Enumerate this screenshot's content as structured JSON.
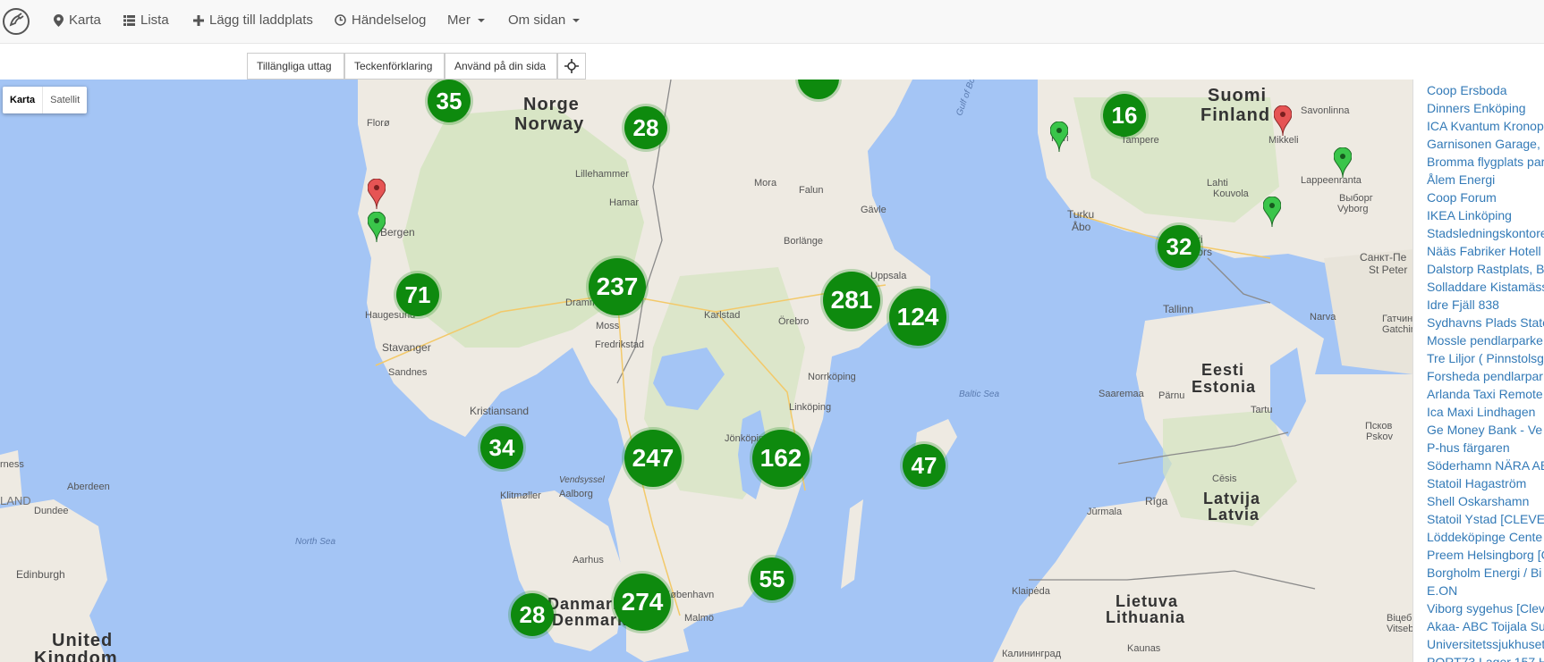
{
  "nav": {
    "items": [
      {
        "label": "Karta",
        "icon": "map-marker-icon"
      },
      {
        "label": "Lista",
        "icon": "list-icon"
      },
      {
        "label": "Lägg till laddplats",
        "icon": "plus-icon"
      },
      {
        "label": "Händelselog",
        "icon": "clock-icon"
      },
      {
        "label": "Mer",
        "icon": "caret-icon"
      },
      {
        "label": "Om sidan",
        "icon": "caret-icon"
      }
    ]
  },
  "toolbar": {
    "available_label": "Tillängliga uttag",
    "legend_label": "Teckenförklaring",
    "use_label": "Använd på din sida",
    "locate_icon": "crosshair-icon"
  },
  "map": {
    "type_control": {
      "map_label": "Karta",
      "satellite_label": "Satellit"
    },
    "clusters": [
      35,
      28,
      16,
      32,
      71,
      237,
      281,
      124,
      34,
      247,
      162,
      47,
      55,
      274,
      28
    ],
    "labels": {
      "norge": "Norge",
      "norway": "Norway",
      "suomi": "Suomi",
      "finland": "Finland",
      "eesti": "Eesti",
      "estonia": "Estonia",
      "latvija": "Latvija",
      "latvia": "Latvia",
      "lietuva": "Lietuva",
      "lithuania": "Lithuania",
      "united": "United",
      "kingdom": "Kingdom",
      "danmark": "Danmark",
      "denmark": "Denmark",
      "north_sea": "North Sea",
      "baltic_sea": "Baltic Sea",
      "gulf_bothnia": "Gulf of Both",
      "floro": "Florø",
      "bergen": "Bergen",
      "haugesund": "Haugesund",
      "stavanger": "Stavanger",
      "sandnes": "Sandnes",
      "kristiansand": "Kristiansand",
      "lillehammer": "Lillehammer",
      "hamar": "Hamar",
      "drammen": "Dramm",
      "moss": "Moss",
      "fredrikstad": "Fredrikstad",
      "karlstad": "Karlstad",
      "orebro": "Örebro",
      "mora": "Mora",
      "falun": "Falun",
      "borlange": "Borlänge",
      "gavle": "Gävle",
      "uppsala": "Uppsala",
      "norrkoping": "Norrköping",
      "linkoping": "Linköping",
      "jonkoping": "Jönköping",
      "vendsyssel": "Vendsyssel",
      "aalborg": "Aalborg",
      "klitmoller": "Klitmøller",
      "aarhus": "Aarhus",
      "kobenhavn": "København",
      "malmo": "Malmö",
      "aberdeen": "Aberdeen",
      "dundee": "Dundee",
      "edinburgh": "Edinburgh",
      "land": "LAND",
      "rness": "rness",
      "pori": "Pori",
      "tampere": "Tampere",
      "mikkeli": "Mikkeli",
      "savonlinna": "Savonlinna",
      "lahti": "Lahti",
      "kouvola": "Kouvola",
      "lappeenranta": "Lappeenranta",
      "turku": "Turku",
      "abo": "Åbo",
      "helsinki": "ki",
      "helsingfors": "fors",
      "vyborg": "Выборг",
      "vyborg_en": "Vyborg",
      "spb": "Санкт-Пе",
      "spb_en": "St Peter",
      "tallinn": "Tallinn",
      "narva": "Narva",
      "gatchina": "Гатчин",
      "gatchina_en": "Gatchin",
      "saaremaa": "Saaremaa",
      "parnu": "Pärnu",
      "tartu": "Tartu",
      "pskov": "Псков",
      "pskov_en": "Pskov",
      "riga": "Rīga",
      "jurmala": "Jūrmala",
      "cesis": "Cēsis",
      "klaipeda": "Klaipėda",
      "kaunas": "Kaunas",
      "kaliningrad": "Калининград",
      "vitebsk": "Віцеб",
      "vitebsk_en": "Vitseb"
    }
  },
  "sidebar": {
    "items": [
      "Coop Ersboda",
      "Dinners Enköping",
      "ICA Kvantum Kronop",
      "Garnisonen Garage,",
      "Bromma flygplats par",
      "Ålem Energi",
      "Coop Forum",
      "IKEA Linköping",
      "Stadsledningskontore",
      "Nääs Fabriker Hotell",
      "Dalstorp Rastplats, B",
      "Solladdare Kistamäss",
      "Idre Fjäll 838",
      "Sydhavns Plads State",
      "Mossle pendlarparke",
      "Tre Liljor ( Pinnstolsg",
      "Forsheda pendlarpar",
      "Arlanda Taxi Remote",
      "Ica Maxi Lindhagen",
      "Ge Money Bank - Ve",
      "P-hus färgaren",
      "Söderhamn NÄRA AB",
      "Statoil Hagaström",
      "Shell Oskarshamn",
      "Statoil Ystad [CLEVE",
      "Löddeköpinge Cente",
      "Preem Helsingborg [C",
      "Borgholm Energi / Bi",
      "E.ON",
      "Viborg sygehus [Clev",
      "Akaa- ABC Toijala Su",
      "Universitetssjukhuset",
      "PORT73 Lager 157 H"
    ]
  },
  "colors": {
    "cluster": "#0e8a0e",
    "water": "#a4c5f5",
    "land": "#eeeae2",
    "forest": "#d4e4c0",
    "pin_red": "#e65454",
    "pin_green": "#3ac54a",
    "link": "#337ab7"
  }
}
